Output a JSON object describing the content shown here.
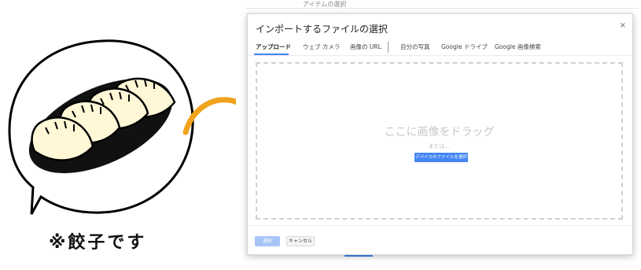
{
  "illustration": {
    "caption": "※餃子です",
    "subject": "gyoza-dumplings",
    "colors": {
      "arrow": "#f0a31c",
      "plate": "#111111",
      "dumpling": "#fff7d6",
      "outline": "#000000"
    }
  },
  "background_page": {
    "top_text": "アイテムの選択"
  },
  "dialog": {
    "title": "インポートするファイルの選択",
    "close_label": "×",
    "tabs": [
      {
        "label": "アップロード",
        "active": true
      },
      {
        "label": "ウェブ カメラ",
        "active": false
      },
      {
        "label": "画像の URL",
        "active": false
      },
      {
        "label": "自分の写真",
        "active": false
      },
      {
        "label": "Google ドライブ",
        "active": false
      },
      {
        "label": "Google 画像検索",
        "active": false
      }
    ],
    "dropzone": {
      "title": "ここに画像をドラッグ",
      "or_text": "または...",
      "select_button": "デバイスのファイルを選択"
    },
    "footer": {
      "select_button": "選択",
      "cancel_button": "キャンセル"
    },
    "accent_color": "#4285f4"
  }
}
